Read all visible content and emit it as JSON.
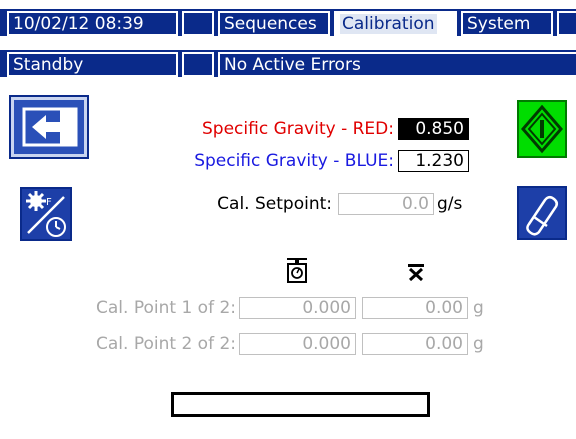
{
  "header": {
    "datetime": "10/02/12 08:39",
    "tabs": [
      "Sequences",
      "Calibration",
      "System"
    ],
    "active_tab": "Calibration",
    "status": "Standby",
    "errors": "No Active Errors"
  },
  "form": {
    "sg_red_label": "Specific Gravity - RED:",
    "sg_red_value": "0.850",
    "sg_blue_label": "Specific Gravity - BLUE:",
    "sg_blue_value": "1.230",
    "setpoint_label": "Cal. Setpoint:",
    "setpoint_value": "0.0",
    "setpoint_unit": "g/s"
  },
  "cal_table": {
    "rows": [
      {
        "label": "Cal. Point 1 of 2:",
        "value1": "0.000",
        "value2": "0.00",
        "unit": "g"
      },
      {
        "label": "Cal. Point 2 of 2:",
        "value1": "0.000",
        "value2": "0.00",
        "unit": "g"
      }
    ]
  },
  "colors": {
    "header_blue": "#0a2a8a",
    "red_label": "#e00000",
    "blue_label": "#1a1ae0",
    "green_button": "#00dd00",
    "disabled_text": "#a8a8a8"
  },
  "icons": {
    "exit": "exit-arrow-icon",
    "settings_timer": "gear-clock-icon",
    "start": "start-diamond-icon",
    "erase": "eraser-icon",
    "scale": "scale-icon",
    "calc": "x-bar-icon"
  }
}
